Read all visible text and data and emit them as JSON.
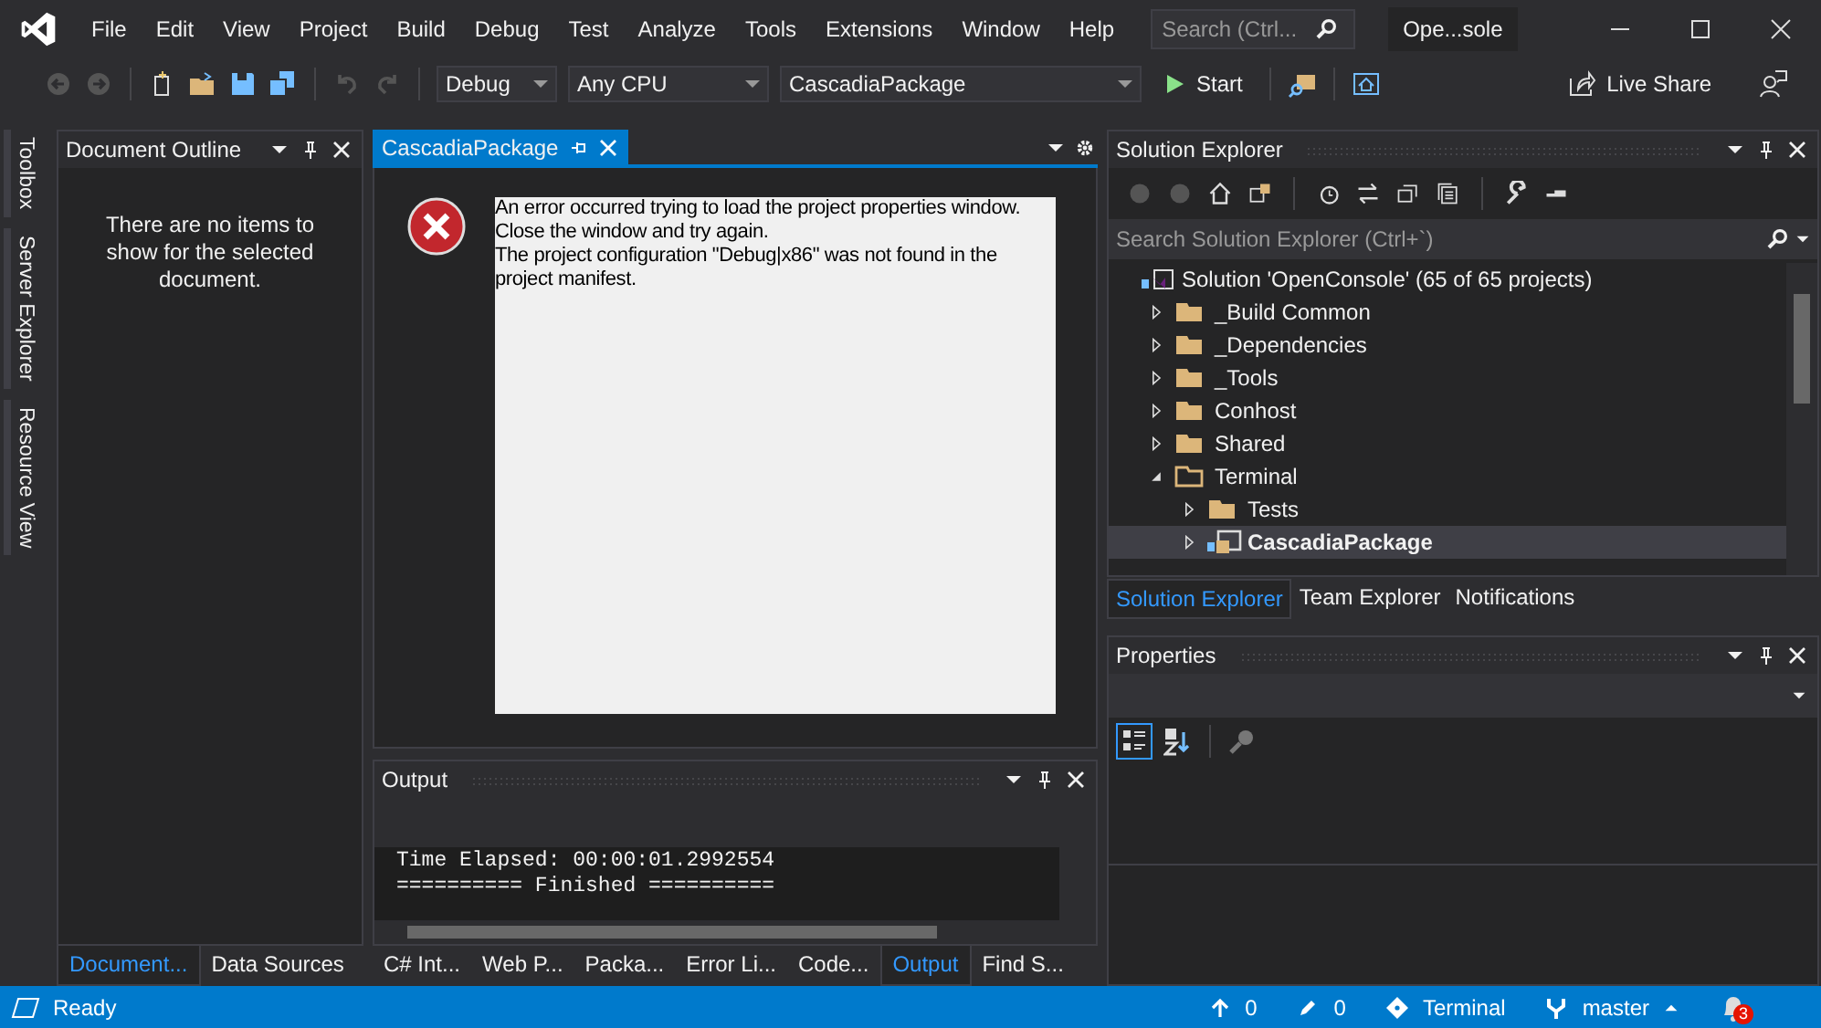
{
  "menu": {
    "items": [
      "File",
      "Edit",
      "View",
      "Project",
      "Build",
      "Debug",
      "Test",
      "Analyze",
      "Tools",
      "Extensions",
      "Window",
      "Help"
    ],
    "search_placeholder": "Search (Ctrl...",
    "solution_name": "Ope...sole"
  },
  "toolbar": {
    "configuration": "Debug",
    "platform": "Any CPU",
    "startup_project": "CascadiaPackage",
    "start": "Start",
    "live_share": "Live Share"
  },
  "side_tabs": [
    "Toolbox",
    "Server Explorer",
    "Resource View"
  ],
  "document_outline": {
    "title": "Document Outline",
    "message": "There are no items to show for the selected document."
  },
  "left_tabs": [
    {
      "label": "Document...",
      "selected": true
    },
    {
      "label": "Data Sources",
      "selected": false
    }
  ],
  "editor": {
    "tab": "CascadiaPackage",
    "error_lines": [
      "An error occurred trying to load the project properties window.",
      "Close the window and try again.",
      "The project configuration \"Debug|x86\" was not found in the",
      "project manifest."
    ]
  },
  "output": {
    "title": "Output",
    "lines": [
      "Time Elapsed: 00:00:01.2992554",
      "========== Finished =========="
    ]
  },
  "center_tabs": [
    {
      "label": "C# Int...",
      "selected": false
    },
    {
      "label": "Web P...",
      "selected": false
    },
    {
      "label": "Packa...",
      "selected": false
    },
    {
      "label": "Error Li...",
      "selected": false
    },
    {
      "label": "Code...",
      "selected": false
    },
    {
      "label": "Output",
      "selected": true
    },
    {
      "label": "Find S...",
      "selected": false
    }
  ],
  "solution_explorer": {
    "title": "Solution Explorer",
    "search_placeholder": "Search Solution Explorer (Ctrl+`)",
    "tree": [
      {
        "kind": "solution",
        "label": "Solution 'OpenConsole' (65 of 65 projects)",
        "selected": false,
        "children": [
          {
            "kind": "folder",
            "label": "_Build Common",
            "expanded": false,
            "selected": false
          },
          {
            "kind": "folder",
            "label": "_Dependencies",
            "expanded": false,
            "selected": false
          },
          {
            "kind": "folder",
            "label": "_Tools",
            "expanded": false,
            "selected": false
          },
          {
            "kind": "folder",
            "label": "Conhost",
            "expanded": false,
            "selected": false
          },
          {
            "kind": "folder",
            "label": "Shared",
            "expanded": false,
            "selected": false
          },
          {
            "kind": "folder",
            "label": "Terminal",
            "expanded": true,
            "selected": false,
            "children": [
              {
                "kind": "folder",
                "label": "Tests",
                "expanded": false,
                "selected": false
              },
              {
                "kind": "project",
                "label": "CascadiaPackage",
                "expanded": false,
                "selected": true
              }
            ]
          }
        ]
      }
    ]
  },
  "right_tabs": [
    {
      "label": "Solution Explorer",
      "selected": true
    },
    {
      "label": "Team Explorer",
      "selected": false
    },
    {
      "label": "Notifications",
      "selected": false
    }
  ],
  "properties": {
    "title": "Properties"
  },
  "status_bar": {
    "message": "Ready",
    "unpushed": "0",
    "changes": "0",
    "repository": "Terminal",
    "branch": "master",
    "notifications": "3"
  }
}
